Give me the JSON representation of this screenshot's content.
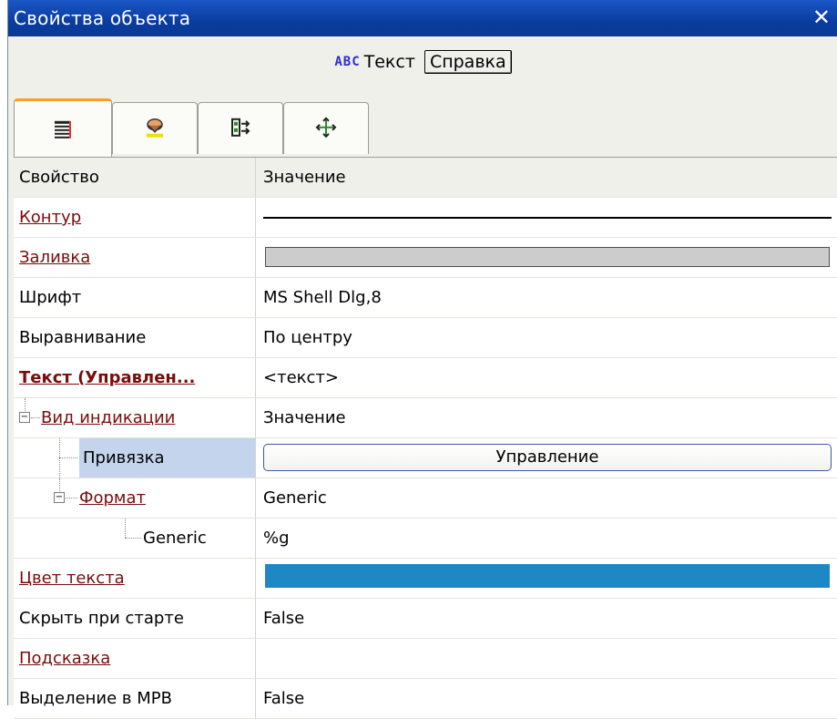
{
  "window": {
    "title": "Свойства объекта",
    "close_glyph": "✕"
  },
  "object": {
    "type_badge": "ABC",
    "name": "Текст",
    "help_label": "Справка"
  },
  "tabs": [
    {
      "icon": "properties-list-icon",
      "active": true
    },
    {
      "icon": "paint-bucket-icon",
      "active": false
    },
    {
      "icon": "layout-arrows-icon",
      "active": false
    },
    {
      "icon": "move-arrows-icon",
      "active": false
    }
  ],
  "grid": {
    "header": {
      "property": "Свойство",
      "value": "Значение"
    },
    "rows": [
      {
        "name": "Контур",
        "value": ""
      },
      {
        "name": "Заливка",
        "value": ""
      },
      {
        "name": "Шрифт",
        "value": "MS Shell Dlg,8"
      },
      {
        "name": "Выравнивание",
        "value": "По центру"
      },
      {
        "name": "Текст (Управлен...",
        "value": "<текст>"
      },
      {
        "name": "Вид индикации",
        "value": "Значение"
      },
      {
        "name": "Привязка",
        "value": "Управление"
      },
      {
        "name": "Формат",
        "value": "Generic"
      },
      {
        "name": "Generic",
        "value": "%g"
      },
      {
        "name": "Цвет текста",
        "value": ""
      },
      {
        "name": "Скрыть при старте",
        "value": "False"
      },
      {
        "name": "Подсказка",
        "value": ""
      },
      {
        "name": "Выделение в МРВ",
        "value": "False"
      }
    ]
  },
  "colors": {
    "titlebar": "#0a3c9e",
    "link": "#7a0c0c",
    "text_color_value": "#1e88c6",
    "fill_value": "#cccccc",
    "selection": "#c4d4ec",
    "active_tab_accent": "#f3a32c"
  }
}
